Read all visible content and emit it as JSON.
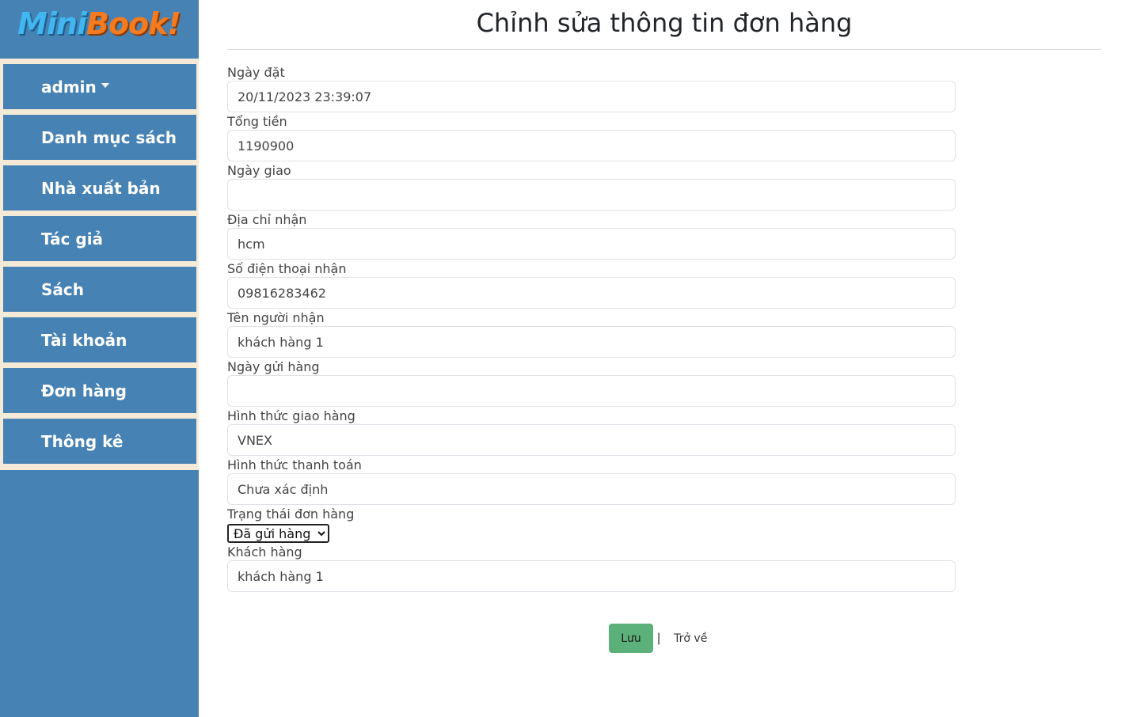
{
  "logo": {
    "part1": "Mini",
    "part2": "Book!"
  },
  "sidebar": {
    "items": [
      {
        "label": "admin"
      },
      {
        "label": "Danh mục sách"
      },
      {
        "label": "Nhà xuất bản"
      },
      {
        "label": "Tác giả"
      },
      {
        "label": "Sách"
      },
      {
        "label": "Tài khoản"
      },
      {
        "label": "Đơn hàng"
      },
      {
        "label": "Thông kê"
      }
    ]
  },
  "page": {
    "title": "Chỉnh sửa thông tin đơn hàng"
  },
  "form": {
    "ngay_dat": {
      "label": "Ngày đặt",
      "value": "20/11/2023 23:39:07"
    },
    "tong_tien": {
      "label": "Tổng tiền",
      "value": "1190900"
    },
    "ngay_giao": {
      "label": "Ngày giao",
      "value": ""
    },
    "dia_chi": {
      "label": "Địa chỉ nhận",
      "value": "hcm"
    },
    "sdt": {
      "label": "Số điện thoại nhận",
      "value": "09816283462"
    },
    "ten_nguoi_nhan": {
      "label": "Tên người nhận",
      "value": "khách hàng 1"
    },
    "ngay_gui": {
      "label": "Ngày gửi hàng",
      "value": ""
    },
    "hinh_thuc_giao": {
      "label": "Hình thức giao hàng",
      "value": "VNEX"
    },
    "hinh_thuc_tt": {
      "label": "Hình thức thanh toán",
      "value": "Chưa xác định"
    },
    "trang_thai": {
      "label": "Trạng thái đơn hàng",
      "selected": "Đã gửi hàng"
    },
    "khach_hang": {
      "label": "Khách hàng",
      "value": "khách hàng 1"
    }
  },
  "actions": {
    "save_label": "Lưu",
    "separator": "|",
    "back_label": "Trở về"
  },
  "colors": {
    "sidebar_bg": "#4682b4",
    "menu_bg": "#f5ead7",
    "save_button": "#5cb17a"
  }
}
